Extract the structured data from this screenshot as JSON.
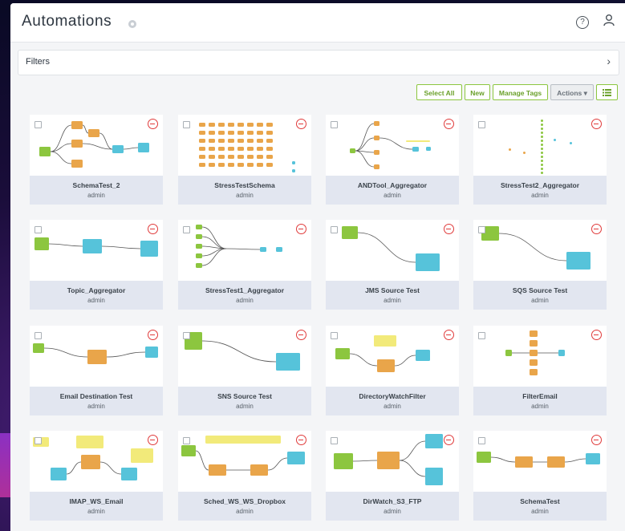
{
  "header": {
    "title": "Automations"
  },
  "filters": {
    "label": "Filters"
  },
  "toolbar": {
    "select_all": "Select All",
    "new": "New",
    "manage_tags": "Manage Tags",
    "actions": "Actions ▾"
  },
  "cards": [
    {
      "name": "SchemaTest_2",
      "owner": "admin"
    },
    {
      "name": "StressTestSchema",
      "owner": "admin"
    },
    {
      "name": "ANDTool_Aggregator",
      "owner": "admin"
    },
    {
      "name": "StressTest2_Aggregator",
      "owner": "admin"
    },
    {
      "name": "Topic_Aggregator",
      "owner": "admin"
    },
    {
      "name": "StressTest1_Aggregator",
      "owner": "admin"
    },
    {
      "name": "JMS Source Test",
      "owner": "admin"
    },
    {
      "name": "SQS Source Test",
      "owner": "admin"
    },
    {
      "name": "Email Destination Test",
      "owner": "admin"
    },
    {
      "name": "SNS Source Test",
      "owner": "admin"
    },
    {
      "name": "DirectoryWatchFilter",
      "owner": "admin"
    },
    {
      "name": "FilterEmail",
      "owner": "admin"
    },
    {
      "name": "IMAP_WS_Email",
      "owner": "admin"
    },
    {
      "name": "Sched_WS_WS_Dropbox",
      "owner": "admin"
    },
    {
      "name": "DirWatch_S3_FTP",
      "owner": "admin"
    },
    {
      "name": "SchemaTest",
      "owner": "admin"
    }
  ],
  "colors": {
    "accent_green": "#8cc63f",
    "node_orange": "#e9a54a",
    "node_teal": "#56c3da",
    "delete_red": "#e03a3a"
  },
  "icons": [
    "info-icon",
    "help-icon",
    "user-icon",
    "chevron-right-icon",
    "list-view-icon",
    "delete-icon"
  ]
}
